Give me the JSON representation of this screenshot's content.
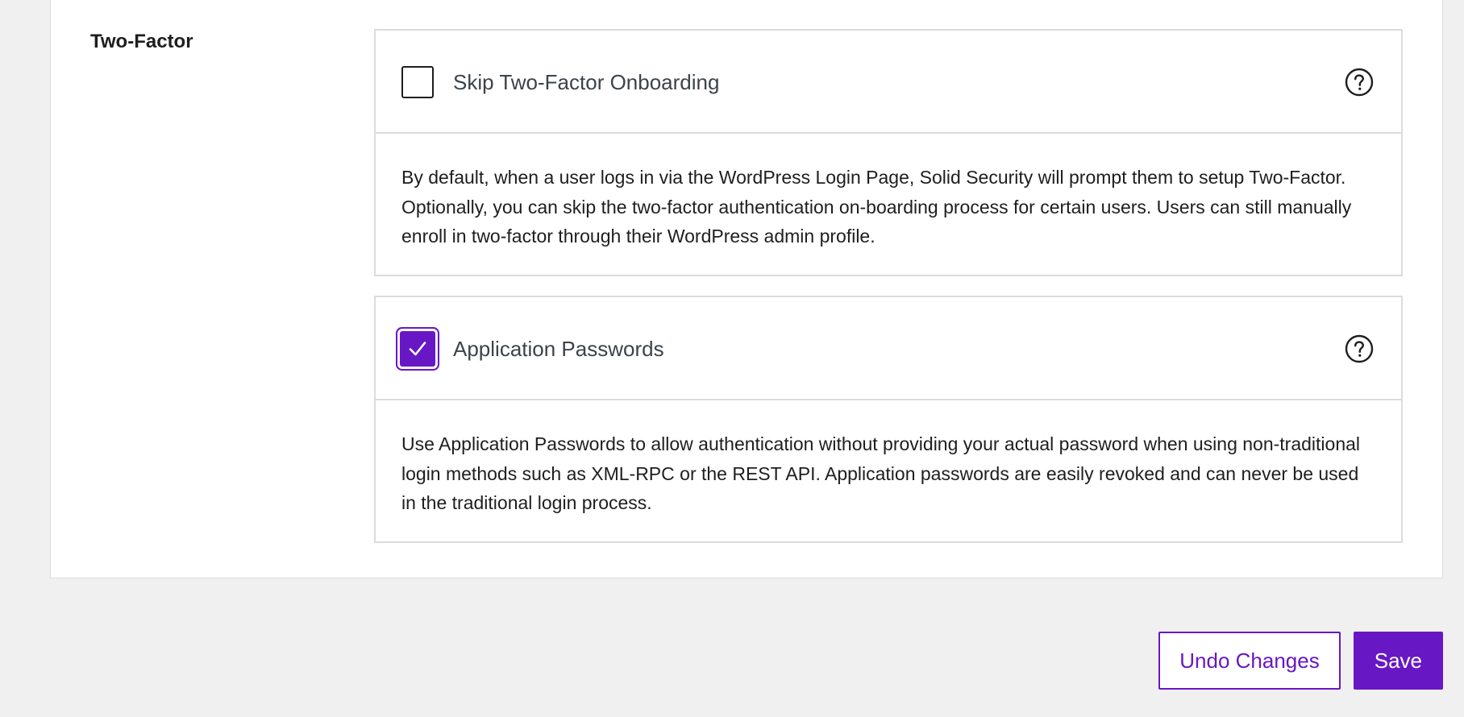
{
  "section": {
    "label": "Two-Factor"
  },
  "settings": [
    {
      "title": "Skip Two-Factor Onboarding",
      "checked": false,
      "description": "By default, when a user logs in via the WordPress Login Page, Solid Security will prompt them to setup Two-Factor. Optionally, you can skip the two-factor authentication on-boarding process for certain users. Users can still manually enroll in two-factor through their WordPress admin profile."
    },
    {
      "title": "Application Passwords",
      "checked": true,
      "description": "Use Application Passwords to allow authentication without providing your actual password when using non-traditional login methods such as XML-RPC or the REST API. Application passwords are easily revoked and can never be used in the traditional login process."
    }
  ],
  "footer": {
    "undo_label": "Undo Changes",
    "save_label": "Save"
  },
  "icons": {
    "help": "help-circle-icon",
    "check": "checkmark-icon"
  },
  "colors": {
    "accent": "#6817c5",
    "background": "#f0f0f1",
    "border": "#dcdcde"
  }
}
